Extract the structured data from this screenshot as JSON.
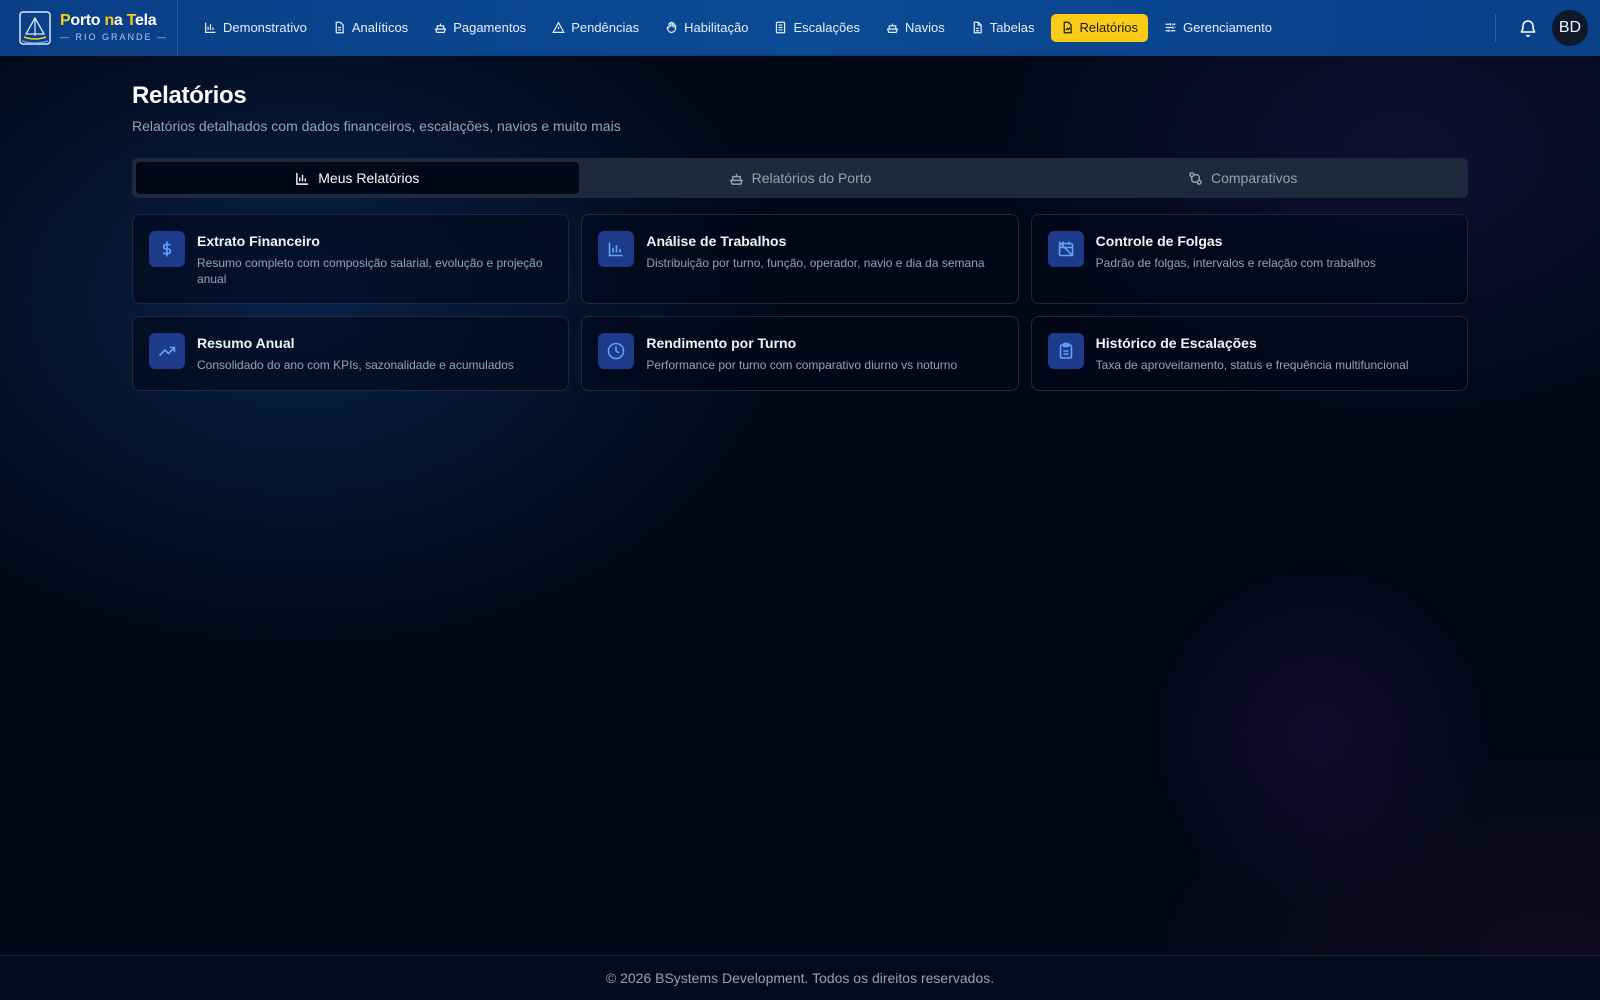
{
  "brand": {
    "name_part1": "P",
    "name_part2": "orto ",
    "name_part3": "n",
    "name_part4": "a ",
    "name_part5": "T",
    "name_part6": "ela",
    "subtitle": "— RIO GRANDE —",
    "accent_color": "#facc15"
  },
  "nav": {
    "items": [
      {
        "label": "Demonstrativo",
        "icon": "bar-chart-icon"
      },
      {
        "label": "Analíticos",
        "icon": "document-icon"
      },
      {
        "label": "Pagamentos",
        "icon": "ship-icon"
      },
      {
        "label": "Pendências",
        "icon": "warning-icon"
      },
      {
        "label": "Habilitação",
        "icon": "hand-icon"
      },
      {
        "label": "Escalações",
        "icon": "list-icon"
      },
      {
        "label": "Navios",
        "icon": "ship-icon"
      },
      {
        "label": "Tabelas",
        "icon": "file-icon"
      },
      {
        "label": "Relatórios",
        "icon": "report-icon",
        "active": true
      },
      {
        "label": "Gerenciamento",
        "icon": "sliders-icon"
      }
    ],
    "avatar_initials": "BD"
  },
  "page": {
    "title": "Relatórios",
    "subtitle": "Relatórios detalhados com dados financeiros, escalações, navios e muito mais"
  },
  "tabs": [
    {
      "label": "Meus Relatórios",
      "icon": "bar-chart-icon",
      "active": true
    },
    {
      "label": "Relatórios do Porto",
      "icon": "ship-icon"
    },
    {
      "label": "Comparativos",
      "icon": "compare-icon"
    }
  ],
  "cards": [
    {
      "title": "Extrato Financeiro",
      "desc": "Resumo completo com composição salarial, evolução e projeção anual",
      "icon": "dollar-icon"
    },
    {
      "title": "Análise de Trabalhos",
      "desc": "Distribuição por turno, função, operador, navio e dia da semana",
      "icon": "bar-chart-icon"
    },
    {
      "title": "Controle de Folgas",
      "desc": "Padrão de folgas, intervalos e relação com trabalhos",
      "icon": "calendar-off-icon"
    },
    {
      "title": "Resumo Anual",
      "desc": "Consolidado do ano com KPIs, sazonalidade e acumulados",
      "icon": "trending-up-icon"
    },
    {
      "title": "Rendimento por Turno",
      "desc": "Performance por turno com comparativo diurno vs noturno",
      "icon": "clock-icon"
    },
    {
      "title": "Histórico de Escalações",
      "desc": "Taxa de aproveitamento, status e frequência multifuncional",
      "icon": "clipboard-icon"
    }
  ],
  "footer": {
    "text": "© 2026 BSystems Development. Todos os direitos reservados."
  }
}
